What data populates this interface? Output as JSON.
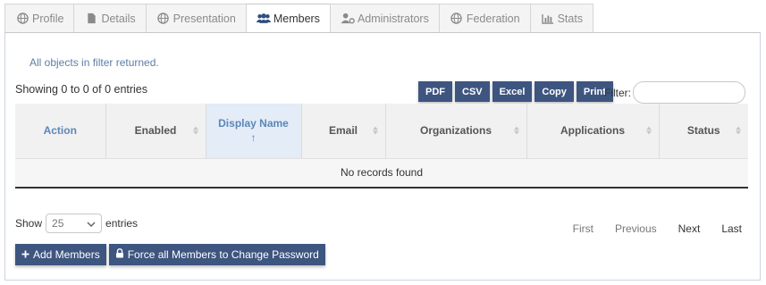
{
  "tabs": [
    {
      "label": "Profile",
      "icon": "globe-icon"
    },
    {
      "label": "Details",
      "icon": "file-icon"
    },
    {
      "label": "Presentation",
      "icon": "globe-icon"
    },
    {
      "label": "Members",
      "icon": "users-icon",
      "active": true
    },
    {
      "label": "Administrators",
      "icon": "user-cog-icon"
    },
    {
      "label": "Federation",
      "icon": "globe-icon"
    },
    {
      "label": "Stats",
      "icon": "bar-chart-icon"
    }
  ],
  "message": "All objects in filter returned.",
  "table_info": "Showing 0 to 0 of 0 entries",
  "export_buttons": [
    "PDF",
    "CSV",
    "Excel",
    "Copy",
    "Print"
  ],
  "filter": {
    "label": "Filter:",
    "value": ""
  },
  "columns": [
    "Action",
    "Enabled",
    "Display Name",
    "Email",
    "Organizations",
    "Applications",
    "Status"
  ],
  "sort_indicator": "↑",
  "empty_text": "No records found",
  "length_menu": {
    "show_label": "Show",
    "value": "25",
    "entries_label": "entries"
  },
  "pagination": {
    "first": "First",
    "previous": "Previous",
    "next": "Next",
    "last": "Last"
  },
  "actions": {
    "add_members": "Add Members",
    "force_password": "Force all Members to Change Password"
  },
  "colors": {
    "accent": "#3e5580",
    "link": "#5b87b8"
  }
}
